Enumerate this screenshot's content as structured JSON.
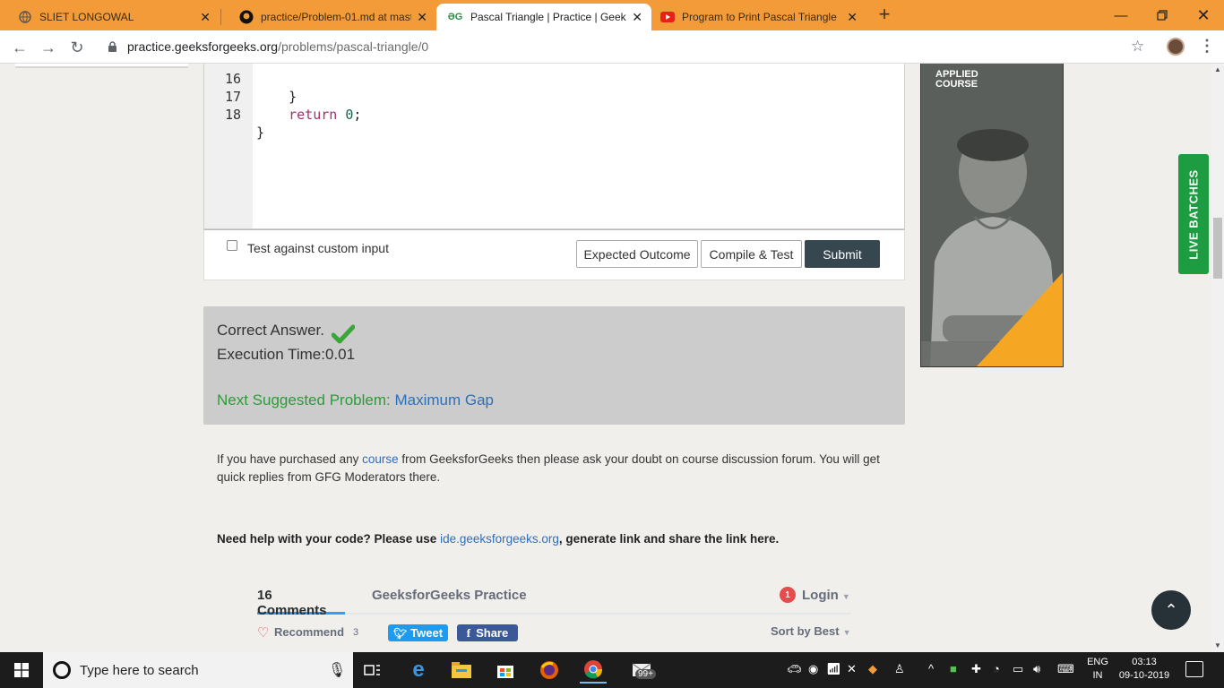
{
  "browser": {
    "tabs": [
      {
        "title": "SLIET LONGOWAL",
        "icon": "globe-icon"
      },
      {
        "title": "practice/Problem-01.md at master",
        "icon": "github-icon"
      },
      {
        "title": "Pascal Triangle | Practice | GeeksforGeeks",
        "icon": "gfg-icon"
      },
      {
        "title": "Program to Print Pascal Triangle",
        "icon": "youtube-icon"
      }
    ],
    "url_host": "practice.geeksforgeeks.org",
    "url_path": "/problems/pascal-triangle/0"
  },
  "editor": {
    "lines": [
      {
        "num": "16",
        "code": "    }"
      },
      {
        "num": "17",
        "code_kw": "return",
        "code_num": "0",
        "indent": "    "
      },
      {
        "num": "18",
        "code": "}"
      }
    ]
  },
  "controls": {
    "custom_input_label": "Test against custom input",
    "expected_label": "Expected Outcome",
    "compile_label": "Compile & Test",
    "submit_label": "Submit"
  },
  "result": {
    "status": "Correct Answer.",
    "execution_time": "Execution Time:0.01",
    "next_label": "Next Suggested Problem:",
    "next_link": "Maximum Gap"
  },
  "info": {
    "before_link": "If you have purchased any ",
    "link": "course",
    "after_link": " from GeeksforGeeks then please ask your doubt on course discussion forum. You will get quick replies from GFG Moderators there."
  },
  "help": {
    "before": "Need help with your code? Please use ",
    "link": "ide.geeksforgeeks.org",
    "after": ", generate link and share the link here."
  },
  "comments": {
    "count_label": "16 Comments",
    "community": "GeeksforGeeks Practice",
    "badge": "1",
    "login": "Login",
    "recommend": "Recommend",
    "recommend_count": "3",
    "tweet": "Tweet",
    "share": "Share",
    "sort": "Sort by Best"
  },
  "ad": {
    "logo_line1": "APPLIED",
    "logo_line2": "COURSE"
  },
  "live_batches": "LIVE BATCHES",
  "taskbar": {
    "search_placeholder": "Type here to search",
    "lang1": "ENG",
    "lang2": "IN",
    "time": "03:13",
    "date": "09-10-2019",
    "mail_badge": "99+"
  },
  "colors": {
    "tab_bar": "#f29b38",
    "submit": "#37474f",
    "correct": "#2d9b3a",
    "link": "#2e6fba",
    "live": "#1e9c41"
  }
}
